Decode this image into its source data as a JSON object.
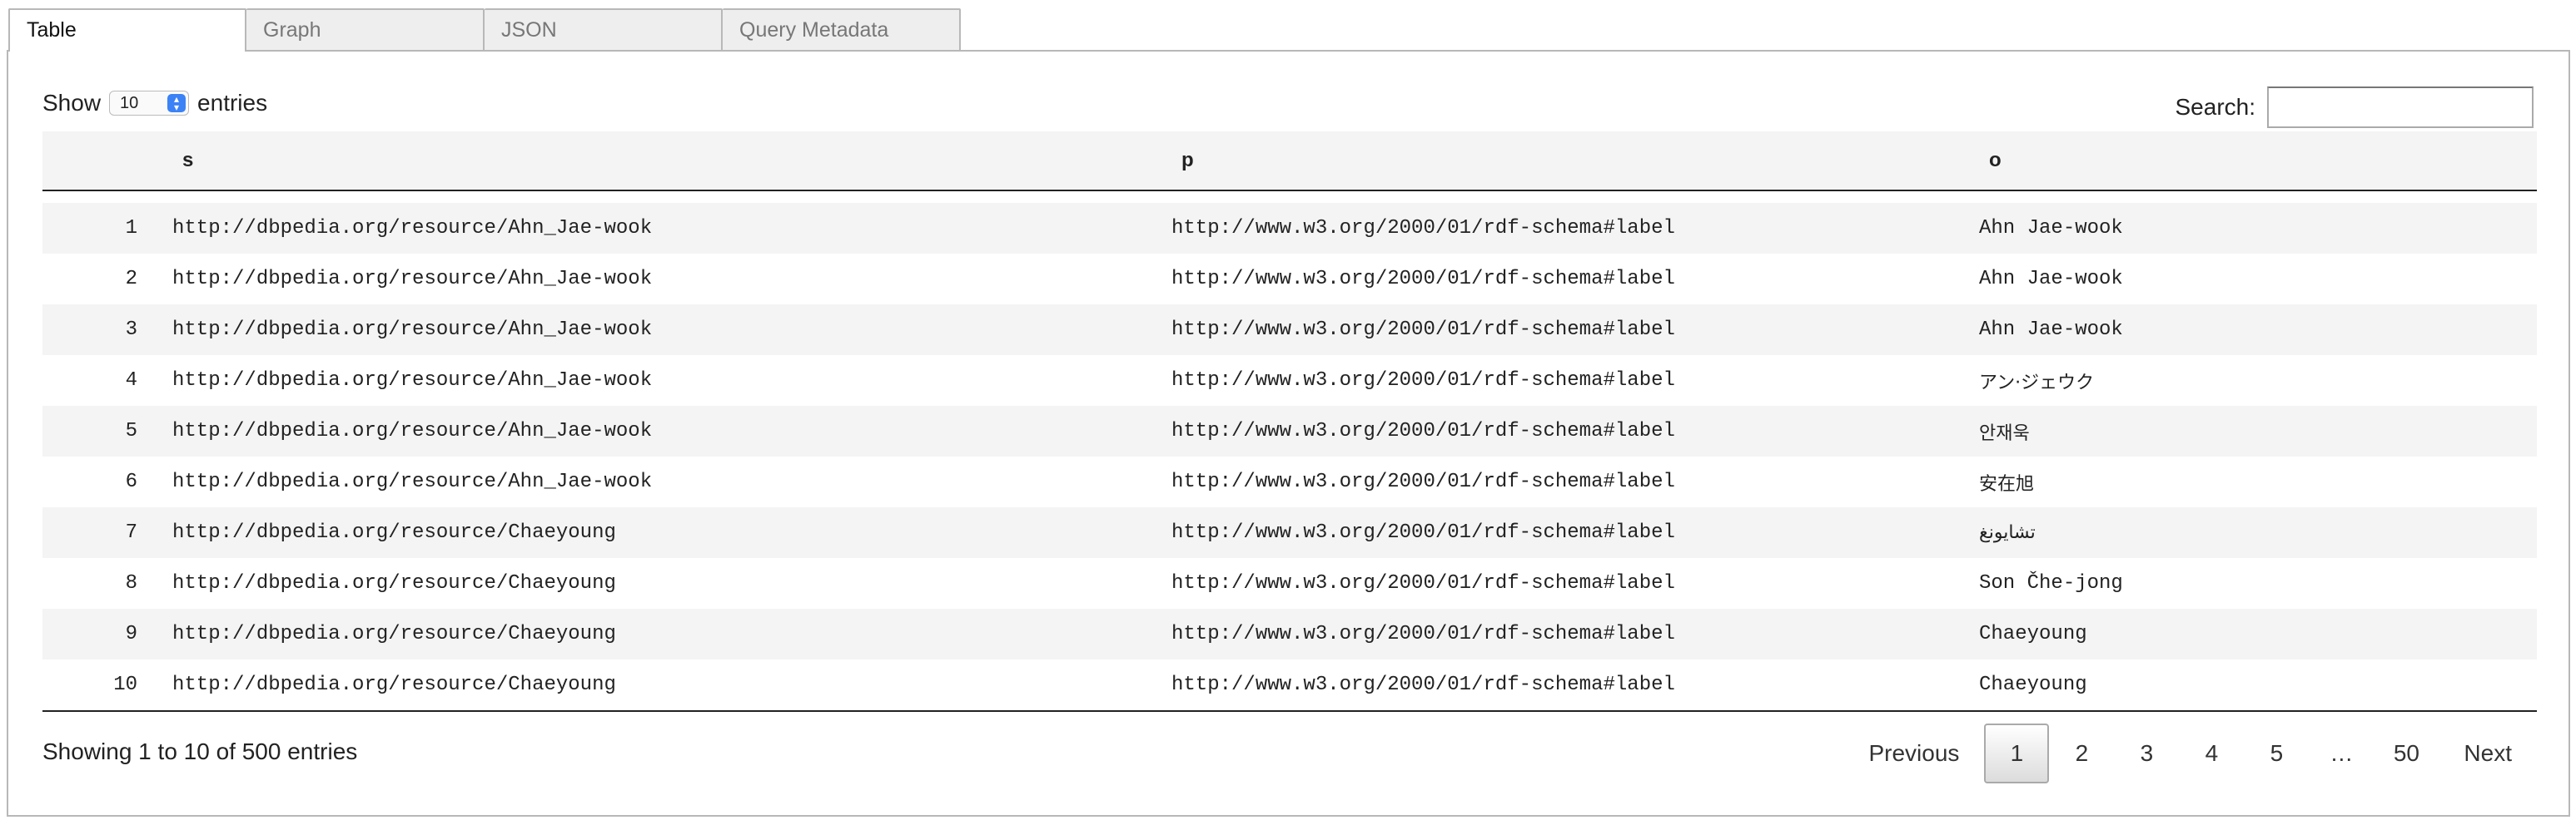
{
  "tabs": [
    {
      "label": "Table",
      "active": true
    },
    {
      "label": "Graph",
      "active": false
    },
    {
      "label": "JSON",
      "active": false
    },
    {
      "label": "Query Metadata",
      "active": false
    }
  ],
  "controls": {
    "show_label": "Show",
    "entries_label": "entries",
    "page_length": "10",
    "search_label": "Search:",
    "search_value": ""
  },
  "table": {
    "headers": {
      "index": "",
      "s": "s",
      "p": "p",
      "o": "o"
    },
    "rows": [
      {
        "index": "1",
        "s": "http://dbpedia.org/resource/Ahn_Jae-wook",
        "p": "http://www.w3.org/2000/01/rdf-schema#label",
        "o": "Ahn Jae-wook"
      },
      {
        "index": "2",
        "s": "http://dbpedia.org/resource/Ahn_Jae-wook",
        "p": "http://www.w3.org/2000/01/rdf-schema#label",
        "o": "Ahn Jae-wook"
      },
      {
        "index": "3",
        "s": "http://dbpedia.org/resource/Ahn_Jae-wook",
        "p": "http://www.w3.org/2000/01/rdf-schema#label",
        "o": "Ahn Jae-wook"
      },
      {
        "index": "4",
        "s": "http://dbpedia.org/resource/Ahn_Jae-wook",
        "p": "http://www.w3.org/2000/01/rdf-schema#label",
        "o": "アン·ジェウク"
      },
      {
        "index": "5",
        "s": "http://dbpedia.org/resource/Ahn_Jae-wook",
        "p": "http://www.w3.org/2000/01/rdf-schema#label",
        "o": "안재욱"
      },
      {
        "index": "6",
        "s": "http://dbpedia.org/resource/Ahn_Jae-wook",
        "p": "http://www.w3.org/2000/01/rdf-schema#label",
        "o": "安在旭"
      },
      {
        "index": "7",
        "s": "http://dbpedia.org/resource/Chaeyoung",
        "p": "http://www.w3.org/2000/01/rdf-schema#label",
        "o": "تشايونغ"
      },
      {
        "index": "8",
        "s": "http://dbpedia.org/resource/Chaeyoung",
        "p": "http://www.w3.org/2000/01/rdf-schema#label",
        "o": "Son Čhe-jong"
      },
      {
        "index": "9",
        "s": "http://dbpedia.org/resource/Chaeyoung",
        "p": "http://www.w3.org/2000/01/rdf-schema#label",
        "o": "Chaeyoung"
      },
      {
        "index": "10",
        "s": "http://dbpedia.org/resource/Chaeyoung",
        "p": "http://www.w3.org/2000/01/rdf-schema#label",
        "o": "Chaeyoung"
      }
    ]
  },
  "footer": {
    "info": "Showing 1 to 10 of 500 entries",
    "pagination": {
      "previous": "Previous",
      "pages": [
        "1",
        "2",
        "3",
        "4",
        "5",
        "…",
        "50"
      ],
      "current": "1",
      "next": "Next"
    }
  }
}
